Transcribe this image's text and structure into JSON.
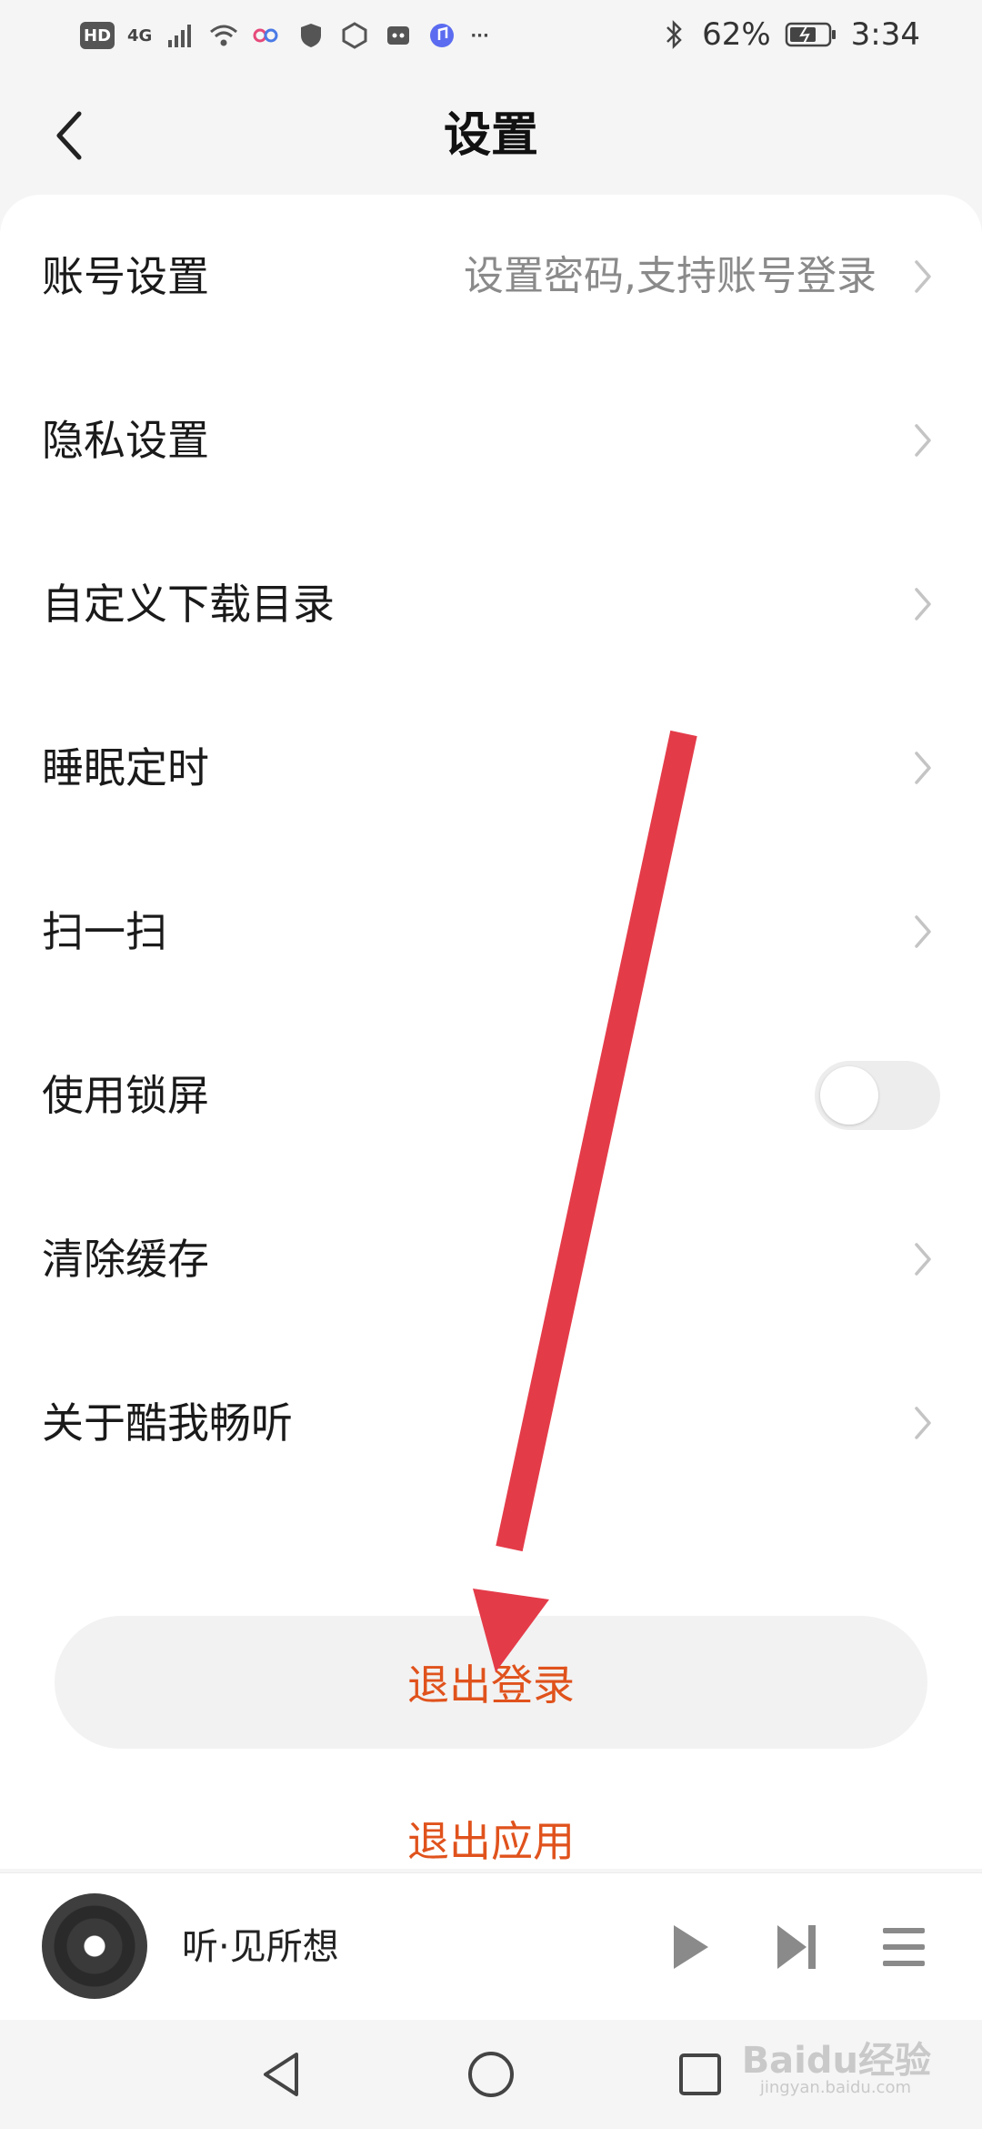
{
  "status_bar": {
    "hd": "HD",
    "network": "4G",
    "battery": "62%",
    "time": "3:34",
    "more": "···"
  },
  "header": {
    "title": "设置"
  },
  "settings": {
    "items": [
      {
        "label": "账号设置",
        "value": "设置密码,支持账号登录"
      },
      {
        "label": "隐私设置"
      },
      {
        "label": "自定义下载目录"
      },
      {
        "label": "睡眠定时"
      },
      {
        "label": "扫一扫"
      },
      {
        "label": "使用锁屏",
        "toggle": false
      },
      {
        "label": "清除缓存"
      },
      {
        "label": "关于酷我畅听"
      }
    ]
  },
  "actions": {
    "logout": "退出登录",
    "exit_app": "退出应用"
  },
  "player": {
    "track": "听·见所想"
  },
  "watermark": {
    "text": "Baidu经验",
    "url_text": "jingyan.baidu.com"
  },
  "colors": {
    "accent": "#e0521c",
    "annotation_arrow": "#e43b49"
  }
}
